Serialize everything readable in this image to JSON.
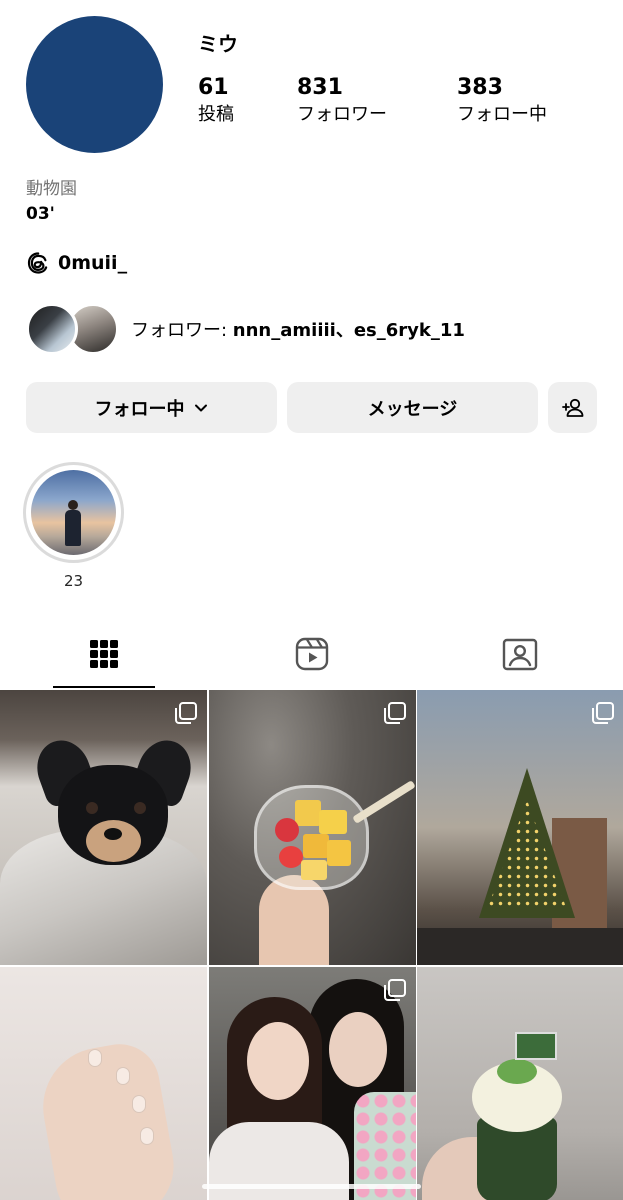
{
  "profile": {
    "username": "ミウ",
    "avatar_color": "#1a4378",
    "stats": {
      "posts": {
        "value": "61",
        "label": "投稿"
      },
      "followers": {
        "value": "831",
        "label": "フォロワー"
      },
      "following": {
        "value": "383",
        "label": "フォロー中"
      }
    },
    "category": "動物園",
    "bio": "03'",
    "threads_handle": "0muii_",
    "mutual_text_prefix": "フォロワー: ",
    "mutual_names": "nnn_amiiii、es_6ryk_11"
  },
  "actions": {
    "follow_label": "フォロー中",
    "message_label": "メッセージ"
  },
  "highlights": [
    {
      "label": "23"
    }
  ],
  "tabs": [
    "grid-icon",
    "reels-icon",
    "tagged-icon"
  ],
  "grid": {
    "posts": [
      {
        "name": "post-dog",
        "multi": true
      },
      {
        "name": "post-fruit-cup",
        "multi": true
      },
      {
        "name": "post-christmas-tree",
        "multi": true
      },
      {
        "name": "post-nails",
        "multi": false
      },
      {
        "name": "post-friends",
        "multi": true
      },
      {
        "name": "post-cupcake",
        "multi": false
      }
    ]
  }
}
